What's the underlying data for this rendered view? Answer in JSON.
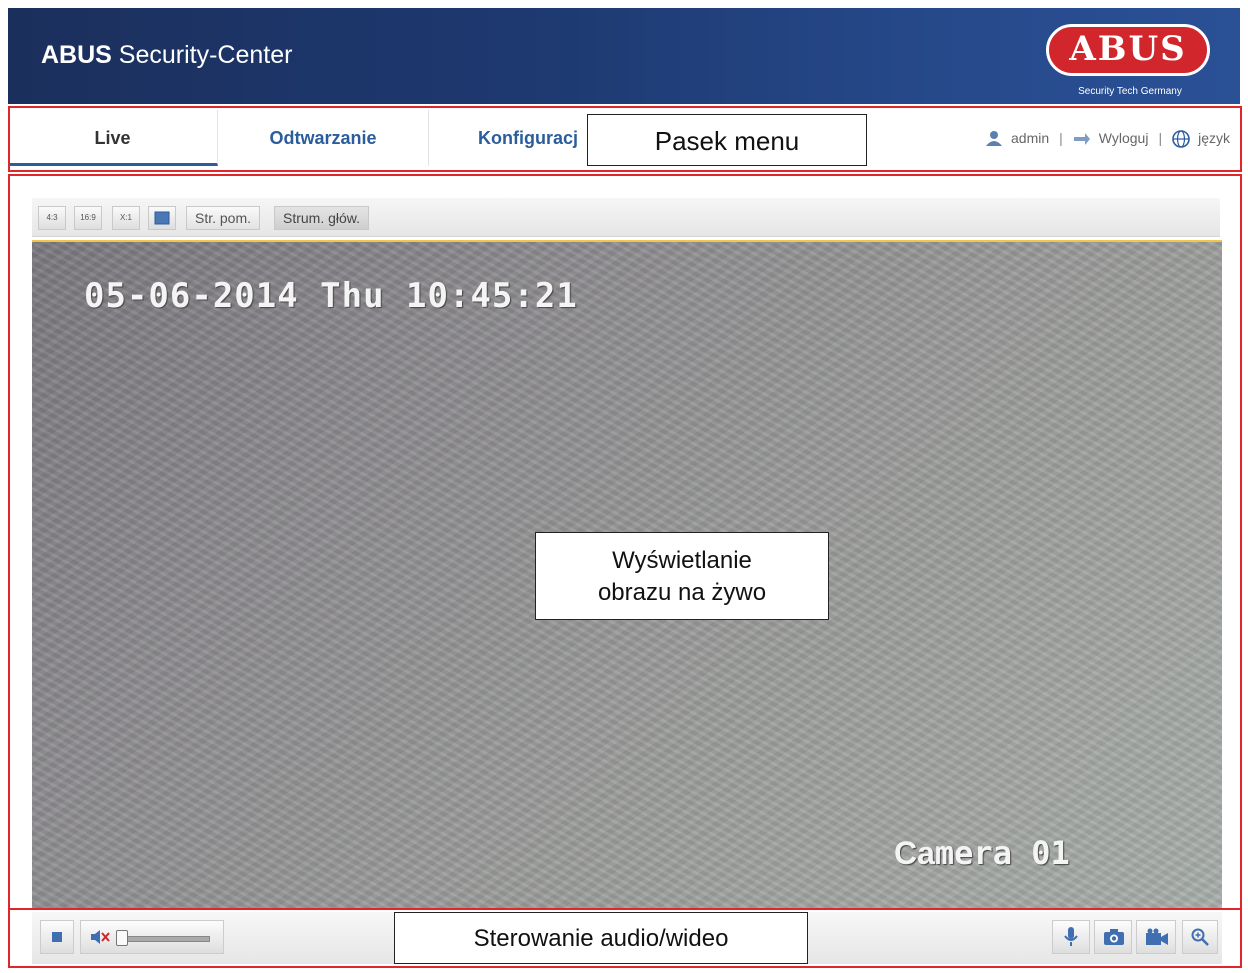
{
  "header": {
    "title_bold": "ABUS",
    "title_rest": " Security-Center",
    "logo_text": "ABUS",
    "logo_tagline": "Security Tech Germany"
  },
  "menu": {
    "tabs": [
      {
        "label": "Live",
        "active": true
      },
      {
        "label": "Odtwarzanie",
        "active": false
      },
      {
        "label": "Konfiguracj",
        "active": false
      }
    ],
    "user": "admin",
    "logout": "Wyloguj",
    "language": "język",
    "separator": "|"
  },
  "toolbar": {
    "buttons": [
      "4:3",
      "16:9",
      "X:1",
      "auto-fill"
    ],
    "sub_stream": "Str. pom.",
    "main_stream": "Strum. głów."
  },
  "video": {
    "timestamp": "05-06-2014 Thu 10:45:21",
    "camera_name_prefix": "Ca",
    "camera_name_suffix": "mera 01"
  },
  "callouts": {
    "menu_bar": "Pasek menu",
    "live_view_line1": "Wyświetlanie",
    "live_view_line2": "obrazu na żywo",
    "av_controls": "Sterowanie audio/wideo"
  },
  "colors": {
    "annotation_red": "#e0262b",
    "tab_blue": "#2b5d9c",
    "logo_red": "#d0262c"
  }
}
